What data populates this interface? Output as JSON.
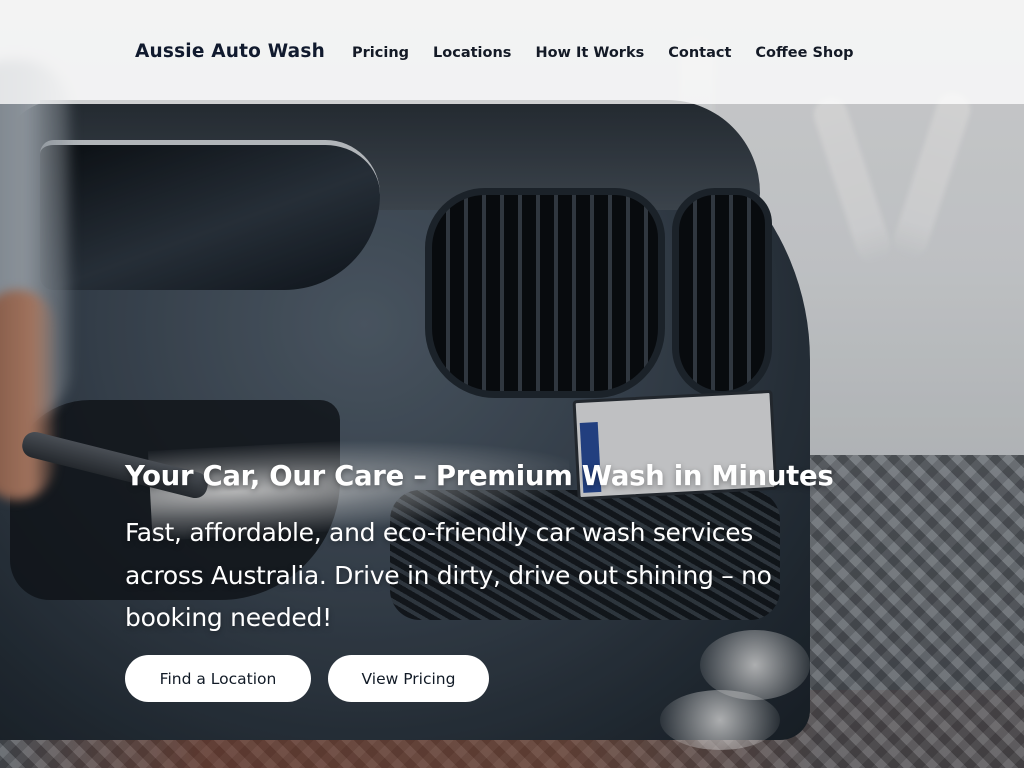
{
  "site": {
    "brand": "Aussie Auto Wash"
  },
  "nav": {
    "items": [
      {
        "label": "Pricing"
      },
      {
        "label": "Locations"
      },
      {
        "label": "How It Works"
      },
      {
        "label": "Contact"
      },
      {
        "label": "Coffee Shop"
      }
    ]
  },
  "hero": {
    "title": "Your Car, Our Care – Premium Wash in Minutes",
    "subtitle": "Fast, affordable, and eco-friendly car wash services across Australia. Drive in dirty, drive out shining – no booking needed!",
    "primary_button": "Find a Location",
    "secondary_button": "View Pricing",
    "background_image": "car-wash-photo"
  },
  "colors": {
    "nav_text": "#141a26",
    "hero_text": "#ffffff",
    "button_bg": "#ffffff"
  }
}
